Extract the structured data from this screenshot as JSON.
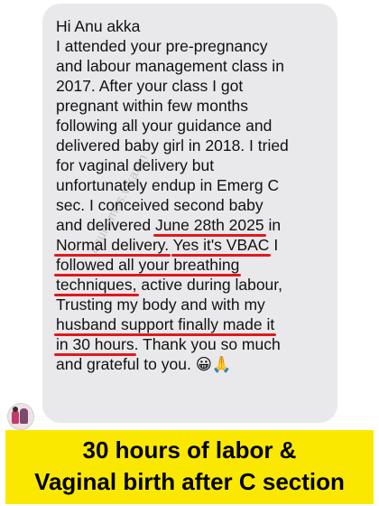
{
  "message": {
    "lines": [
      [
        {
          "t": "Hi Anu akka"
        }
      ],
      [
        {
          "t": "I attended your pre-pregnancy"
        }
      ],
      [
        {
          "t": "and labour management class in"
        }
      ],
      [
        {
          "t": "2017. After your class I got"
        }
      ],
      [
        {
          "t": "pregnant within few months"
        }
      ],
      [
        {
          "t": "following all your guidance and"
        }
      ],
      [
        {
          "t": "delivered baby girl in 2018. I tried"
        }
      ],
      [
        {
          "t": "for vaginal delivery but"
        }
      ],
      [
        {
          "t": "unfortunately endup in Emerg C"
        }
      ],
      [
        {
          "t": "sec. I conceived second baby"
        }
      ],
      [
        {
          "t": "and delivered "
        },
        {
          "t": "June 28th 2025",
          "hl": true
        },
        {
          "t": " in"
        }
      ],
      [
        {
          "t": "Normal delivery.",
          "hl": true
        },
        {
          "t": " "
        },
        {
          "t": "Yes it's VBAC",
          "hl": true
        },
        {
          "t": " I"
        }
      ],
      [
        {
          "t": "followed all your breathing",
          "hl": true
        }
      ],
      [
        {
          "t": "techniques,",
          "hl": true
        },
        {
          "t": " active during labour,"
        }
      ],
      [
        {
          "t": "Trusting my body and with my"
        }
      ],
      [
        {
          "t": "husband support finally made it",
          "hl": true
        }
      ],
      [
        {
          "t": "in 30 hours",
          "hl": true
        },
        {
          "t": ". Thank you so much"
        }
      ],
      [
        {
          "t": "and grateful to you. 😀🙏"
        }
      ]
    ]
  },
  "watermark": "anuhomas.vikatan",
  "banner": {
    "line1": "30 hours of labor &",
    "line2": "Vaginal birth after C section"
  },
  "colors": {
    "bubble": "#e9e9eb",
    "underline": "#e1191f",
    "banner": "#fbe800"
  }
}
